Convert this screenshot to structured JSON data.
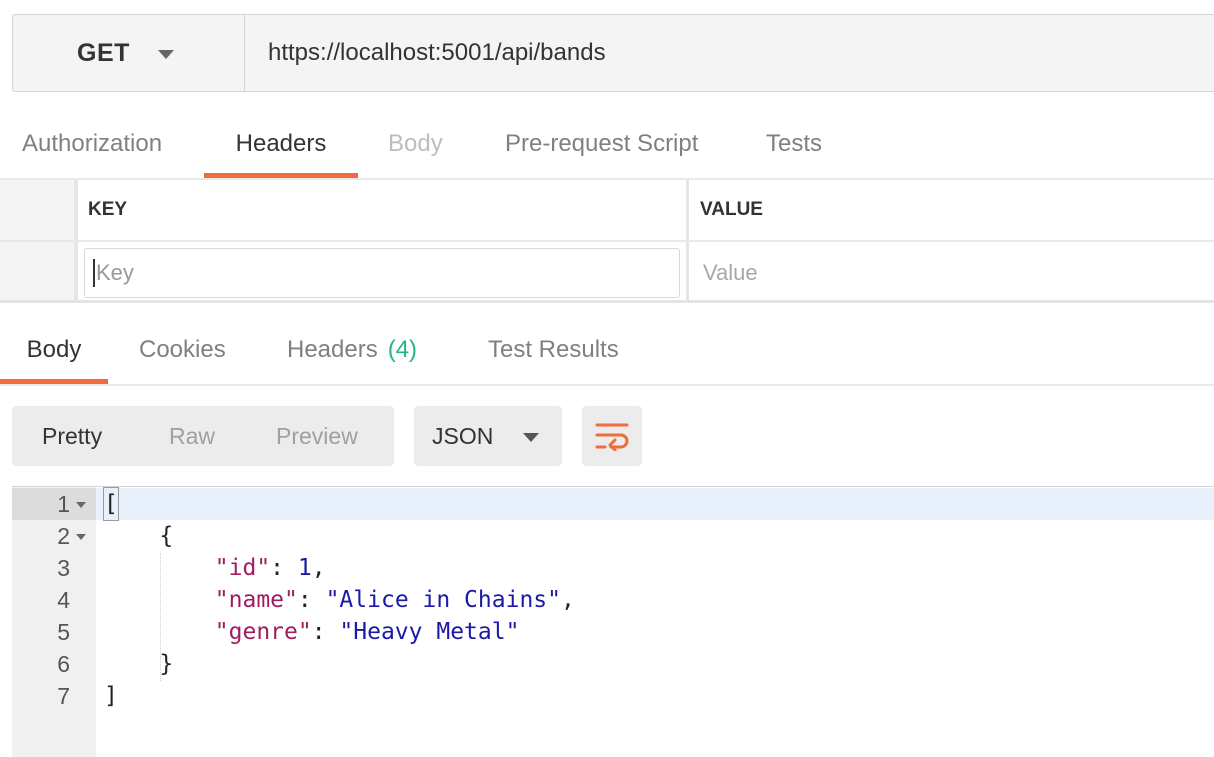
{
  "request": {
    "method": "GET",
    "url": "https://localhost:5001/api/bands"
  },
  "request_tabs": [
    {
      "label": "Authorization",
      "state": "normal"
    },
    {
      "label": "Headers",
      "state": "active"
    },
    {
      "label": "Body",
      "state": "disabled"
    },
    {
      "label": "Pre-request Script",
      "state": "normal"
    },
    {
      "label": "Tests",
      "state": "normal"
    }
  ],
  "headers_table": {
    "key_header": "KEY",
    "value_header": "VALUE",
    "key_placeholder": "Key",
    "value_placeholder": "Value"
  },
  "response_tabs": [
    {
      "label": "Body",
      "state": "active"
    },
    {
      "label": "Cookies",
      "state": "normal"
    },
    {
      "label": "Headers",
      "badge": "(4)",
      "state": "normal"
    },
    {
      "label": "Test Results",
      "state": "normal"
    }
  ],
  "toolbar": {
    "view_modes": [
      "Pretty",
      "Raw",
      "Preview"
    ],
    "active_view": "Pretty",
    "format": "JSON",
    "wrap_icon": "wrap-lines-icon"
  },
  "code": {
    "line_numbers": [
      "1",
      "2",
      "3",
      "4",
      "5",
      "6",
      "7"
    ],
    "lines": [
      "[",
      "    {",
      "        \"id\": 1,",
      "        \"name\": \"Alice in Chains\",",
      "        \"genre\": \"Heavy Metal\"",
      "    }",
      "]"
    ]
  },
  "colors": {
    "accent": "#f26b3a",
    "badge": "#26b47f",
    "json_key": "#a11d60",
    "json_string": "#1a1aa6"
  }
}
